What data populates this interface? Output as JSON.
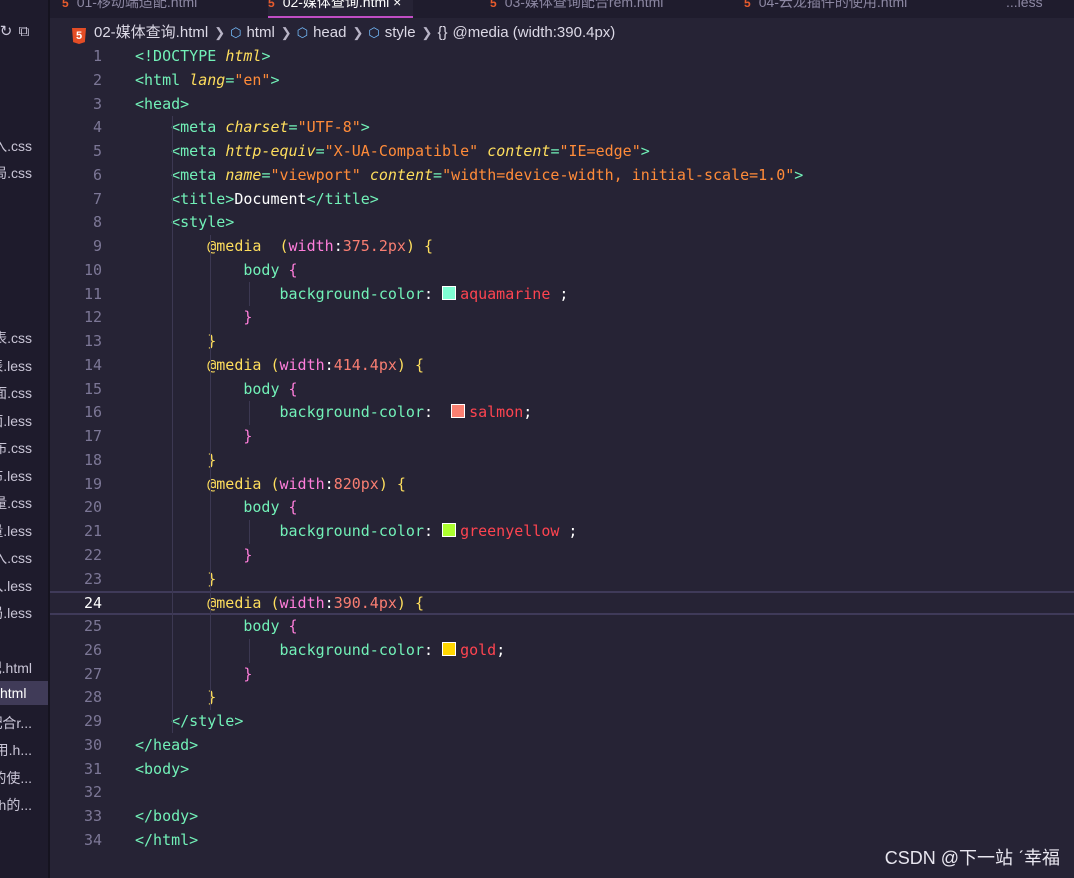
{
  "sidebar": {
    "files": [
      {
        "label": "入.css",
        "top": 0
      },
      {
        "label": "局.css",
        "top": 0
      },
      {
        "label": "表.css",
        "top": 0
      },
      {
        "label": "表.less",
        "top": 0
      },
      {
        "label": "面.css",
        "top": 0
      },
      {
        "label": "面.less",
        "top": 0
      },
      {
        "label": "布.css",
        "top": 0
      },
      {
        "label": "布.less",
        "top": 0
      },
      {
        "label": "量.css",
        "top": 0
      },
      {
        "label": "量.less",
        "top": 0
      },
      {
        "label": "入.css",
        "top": 0
      },
      {
        "label": "入.less",
        "top": 0
      },
      {
        "label": "局.less",
        "top": 0
      },
      {
        "label": "配.html",
        "top": 0
      },
      {
        "label": "html",
        "top": 0,
        "active": true
      },
      {
        "label": "配合r...",
        "top": 0
      },
      {
        "label": "使用.h...",
        "top": 0
      },
      {
        "label": "的使...",
        "top": 0
      },
      {
        "label": "vh的...",
        "top": 0
      }
    ]
  },
  "tabs": [
    {
      "label": "01-移动端适配.html",
      "active": false
    },
    {
      "label": "02-媒体查询.html",
      "active": true,
      "close": "×"
    },
    {
      "label": "03-媒体查询配合rem.html",
      "active": false
    },
    {
      "label": "04-云龙插件的使用.html",
      "active": false
    },
    {
      "label": "...less",
      "active": false
    }
  ],
  "breadcrumb": {
    "file": "02-媒体查询.html",
    "items": [
      "html",
      "head",
      "style"
    ],
    "last": "@media (width:390.4px)"
  },
  "editor": {
    "current_line": 24,
    "swatches": {
      "aquamarine": "#7fffd4",
      "salmon": "#fa8072",
      "greenyellow": "#adff2f",
      "gold": "#ffd700"
    }
  },
  "watermark": "CSDN @下一站 ˊ幸福"
}
